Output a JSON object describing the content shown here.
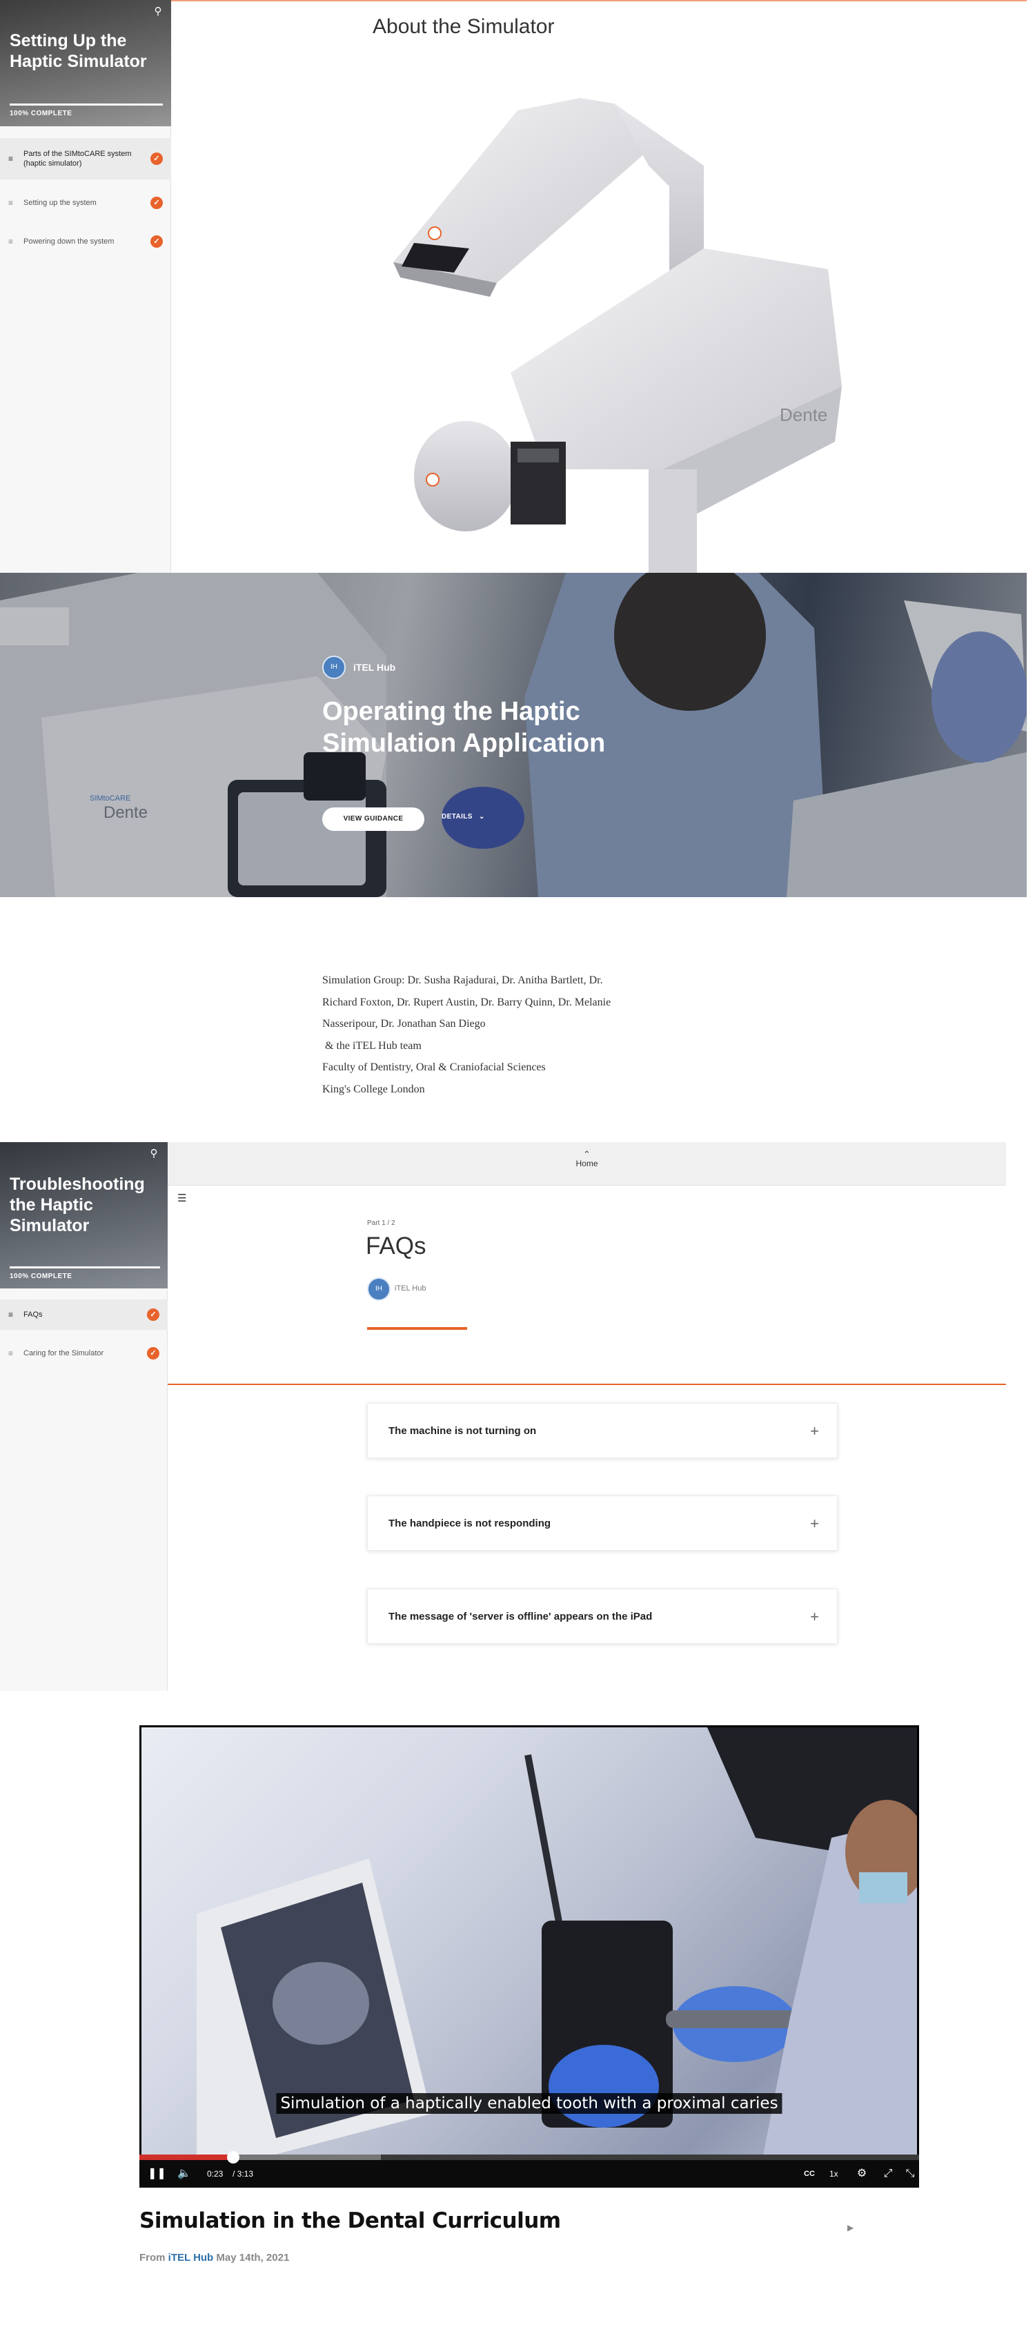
{
  "course1": {
    "title": "Setting Up the Haptic Simulator",
    "progress_percent": 100,
    "progress_label": "100% COMPLETE",
    "lessons": [
      {
        "label": "Parts of the SIMtoCARE system (haptic simulator)",
        "active": true,
        "complete": true
      },
      {
        "label": "Setting up the system",
        "active": false,
        "complete": true
      },
      {
        "label": "Powering down the system",
        "active": false,
        "complete": true
      }
    ],
    "section_title": "About the Simulator",
    "device_brand": "Dente"
  },
  "hero": {
    "badge": "IH",
    "publisher": "iTEL Hub",
    "title": "Operating the Haptic Simulation Application",
    "primary_button": "VIEW GUIDANCE",
    "secondary_button": "DETAILS",
    "device_brand": "Dente",
    "device_badge": "SIMtoCARE"
  },
  "credits": {
    "lines": [
      "Simulation Group: Dr. Susha Rajadurai, Dr. Anitha Bartlett, Dr.",
      "Richard Foxton, Dr. Rupert Austin, Dr. Barry Quinn, Dr. Melanie",
      "Nasseripour, Dr. Jonathan San Diego",
      " & the iTEL Hub team",
      "Faculty of Dentistry, Oral & Craniofacial Sciences",
      "King's College London"
    ]
  },
  "course2": {
    "title": "Troubleshooting the Haptic Simulator",
    "progress_percent": 100,
    "progress_label": "100% COMPLETE",
    "lessons": [
      {
        "label": "FAQs",
        "active": true,
        "complete": true
      },
      {
        "label": "Caring for the Simulator",
        "active": false,
        "complete": true
      }
    ],
    "home_label": "Home",
    "part_label": "Part 1 / 2",
    "page_title": "FAQs",
    "author": "iTEL Hub",
    "author_badge": "IH",
    "faqs": [
      "The machine is not turning on",
      "The handpiece is not responding",
      "The message of 'server is offline' appears on the iPad"
    ]
  },
  "video": {
    "caption": "Simulation of a haptically enabled tooth with a proximal caries",
    "current_time": "0:23",
    "duration": "/ 3:13",
    "played_fraction": 0.12,
    "loaded_fraction": 0.31,
    "speed": "1x",
    "title": "Simulation in the Dental Curriculum",
    "from_label": "From",
    "author": "iTEL Hub",
    "date": "May 14th, 2021"
  },
  "colors": {
    "accent": "#e8632b",
    "badge_blue": "#4a7fc0",
    "progress_red": "#d0302a"
  },
  "icons": [
    "search-icon",
    "list-icon",
    "check-icon",
    "plus-icon",
    "chevron-up-icon",
    "chevron-down-icon",
    "hamburger-icon",
    "pause-icon",
    "volume-icon",
    "cc-icon",
    "settings-icon",
    "fullscreen-icon",
    "expand-icon",
    "play-icon"
  ]
}
